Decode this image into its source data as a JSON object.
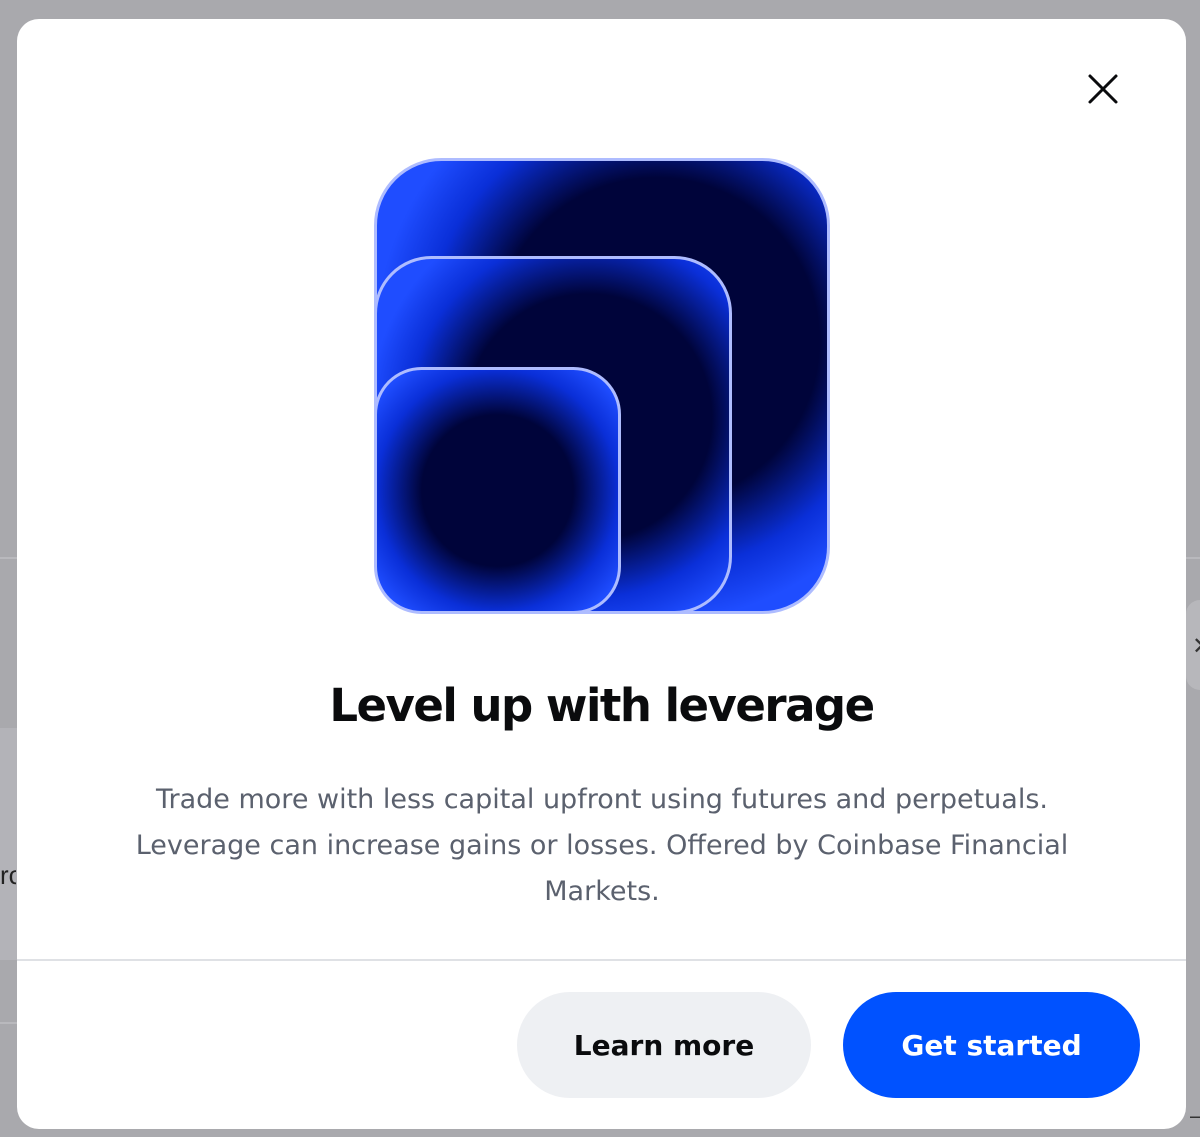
{
  "modal": {
    "close_icon": "close-icon",
    "hero_icon": "nested-squares-leverage-icon",
    "title": "Level up with leverage",
    "description": "Trade more with less capital upfront using futures and perpetuals. Leverage can increase gains or losses. Offered by Coinbase Financial Markets.",
    "secondary_button": "Learn more",
    "primary_button": "Get started"
  },
  "background": {
    "left_edge_text": "rc",
    "right_edge_glyph": "✕",
    "right_edge_dash": "–"
  },
  "colors": {
    "primary": "#0052ff",
    "secondary_bg": "#eef0f3",
    "title": "#0a0b0d",
    "body_text": "#5b616e",
    "hero_dark": "#00043a",
    "hero_glow": "#0a3cff"
  }
}
